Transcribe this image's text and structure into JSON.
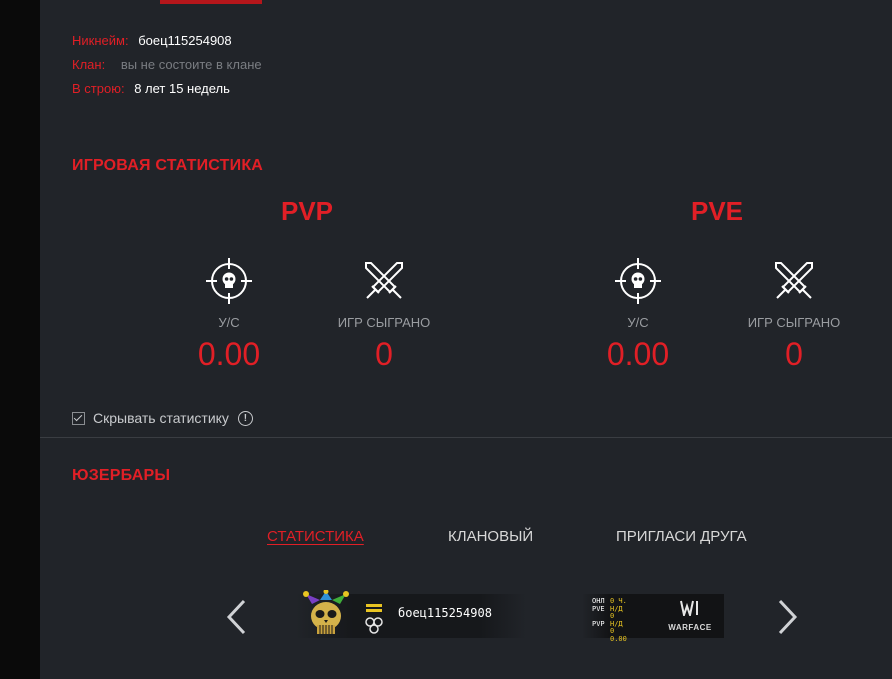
{
  "profile": {
    "nickname_label": "Никнейм:",
    "nickname_value": "боец115254908",
    "clan_label": "Клан:",
    "clan_value": "вы не состоите в клане",
    "service_label": "В строю:",
    "service_value": "8 лет 15 недель"
  },
  "game_stats": {
    "title": "ИГРОВАЯ СТАТИСТИКА",
    "pvp": {
      "title": "PVP",
      "kd_label": "У/С",
      "kd_value": "0.00",
      "games_label": "ИГР СЫГРАНО",
      "games_value": "0"
    },
    "pve": {
      "title": "PVE",
      "kd_label": "У/С",
      "kd_value": "0.00",
      "games_label": "ИГР СЫГРАНО",
      "games_value": "0"
    },
    "hide_label": "Скрывать статистику",
    "hide_checked": true,
    "info_glyph": "!"
  },
  "userbars": {
    "title": "ЮЗЕРБАРЫ",
    "tabs": [
      {
        "label": "Статистика",
        "active": true
      },
      {
        "label": "Клановый",
        "active": false
      },
      {
        "label": "Пригласи друга",
        "active": false
      }
    ],
    "prev_icon": "chevron-left-icon",
    "next_icon": "chevron-right-icon",
    "card": {
      "name": "боец115254908",
      "stats": [
        {
          "key": "ОНЛ",
          "value": "0 Ч."
        },
        {
          "key": "PVE",
          "value": "Н/Д"
        },
        {
          "key": "",
          "value": "0"
        },
        {
          "key": "PVP",
          "value": "Н/Д"
        },
        {
          "key": "",
          "value": "0"
        },
        {
          "key": "",
          "value": "0.00"
        }
      ],
      "logo_text": "WARFACE"
    }
  },
  "colors": {
    "accent": "#e11f26",
    "background": "#212429",
    "muted": "#9a9da1"
  }
}
